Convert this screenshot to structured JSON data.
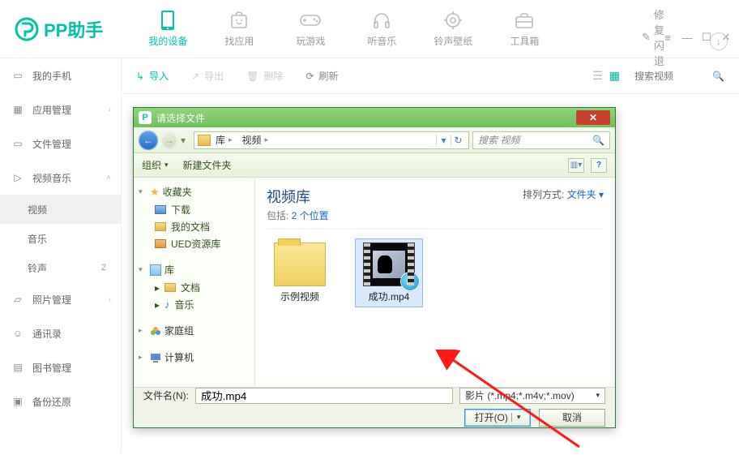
{
  "app": {
    "logo_text": "PP助手",
    "repair": "修复闪退"
  },
  "nav": [
    {
      "label": "我的设备",
      "active": true
    },
    {
      "label": "找应用"
    },
    {
      "label": "玩游戏"
    },
    {
      "label": "听音乐"
    },
    {
      "label": "铃声壁纸"
    },
    {
      "label": "工具箱"
    }
  ],
  "sidebar": {
    "items": [
      {
        "label": "我的手机",
        "icon": "phone"
      },
      {
        "label": "应用管理",
        "icon": "apps",
        "expand": "›"
      },
      {
        "label": "文件管理",
        "icon": "folder"
      },
      {
        "label": "视频音乐",
        "icon": "video",
        "expand": "˄",
        "expanded": true,
        "children": [
          {
            "label": "视频",
            "active": true
          },
          {
            "label": "音乐"
          },
          {
            "label": "铃声",
            "badge": "2"
          }
        ]
      },
      {
        "label": "照片管理",
        "icon": "image",
        "expand": "›"
      },
      {
        "label": "通讯录",
        "icon": "contacts"
      },
      {
        "label": "图书管理",
        "icon": "book"
      },
      {
        "label": "备份还原",
        "icon": "backup"
      }
    ]
  },
  "toolbar": {
    "import": "导入",
    "export": "导出",
    "delete": "删除",
    "refresh": "刷新",
    "search_placeholder": "搜索视频"
  },
  "dialog": {
    "title": "请选择文件",
    "path": {
      "seg1": "库",
      "seg2": "视频"
    },
    "search_placeholder": "搜索 视频",
    "organize": "组织",
    "new_folder": "新建文件夹",
    "library_header": "视频库",
    "includes_prefix": "包括: ",
    "includes_link": "2 个位置",
    "arrange_label": "排列方式: ",
    "arrange_value": "文件夹",
    "tree": {
      "fav": "收藏夹",
      "fav_items": [
        "下载",
        "我的文档",
        "UED资源库"
      ],
      "lib": "库",
      "lib_items": [
        "文档",
        "音乐"
      ],
      "home": "家庭组",
      "computer": "计算机"
    },
    "files": [
      {
        "name": "示例视频",
        "type": "folder"
      },
      {
        "name": "成功.mp4",
        "type": "mp4",
        "selected": true
      }
    ],
    "footer": {
      "filename_label": "文件名(N):",
      "filename_value": "成功.mp4",
      "filter": "影片 (*.mp4;*.m4v;*.mov)",
      "open": "打开(O)",
      "cancel": "取消"
    }
  }
}
